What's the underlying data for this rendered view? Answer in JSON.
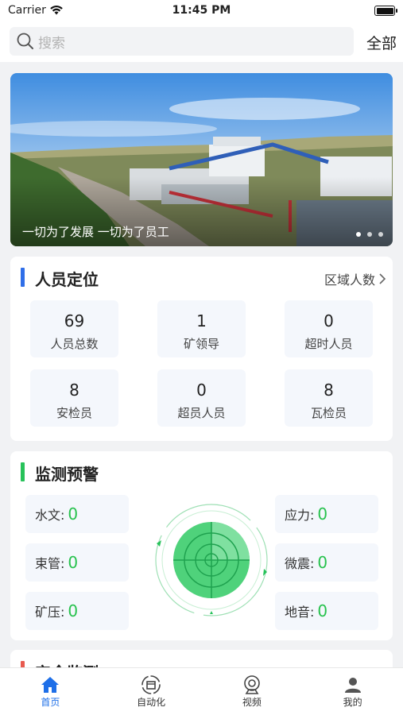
{
  "status_bar": {
    "carrier": "Carrier",
    "time": "11:45 PM"
  },
  "search": {
    "placeholder": "搜索",
    "all_label": "全部"
  },
  "banner": {
    "caption": "一切为了发展 一切为了员工"
  },
  "personnel": {
    "title": "人员定位",
    "more_label": "区域人数",
    "accent": "#2f6ee8",
    "stats": [
      {
        "value": "69",
        "label": "人员总数"
      },
      {
        "value": "1",
        "label": "矿领导"
      },
      {
        "value": "0",
        "label": "超时人员"
      },
      {
        "value": "8",
        "label": "安检员"
      },
      {
        "value": "0",
        "label": "超员人员"
      },
      {
        "value": "8",
        "label": "瓦检员"
      }
    ]
  },
  "monitoring": {
    "title": "监测预警",
    "accent": "#27c25a",
    "left": [
      {
        "label": "水文:",
        "value": "0"
      },
      {
        "label": "束管:",
        "value": "0"
      },
      {
        "label": "矿压:",
        "value": "0"
      }
    ],
    "right": [
      {
        "label": "应力:",
        "value": "0"
      },
      {
        "label": "微震:",
        "value": "0"
      },
      {
        "label": "地音:",
        "value": "0"
      }
    ]
  },
  "safety": {
    "title": "安全监测",
    "accent": "#e85a4f"
  },
  "tabs": [
    {
      "label": "首页",
      "icon": "home-icon",
      "active": true
    },
    {
      "label": "自动化",
      "icon": "automation-icon",
      "active": false
    },
    {
      "label": "视频",
      "icon": "camera-icon",
      "active": false
    },
    {
      "label": "我的",
      "icon": "user-icon",
      "active": false
    }
  ]
}
